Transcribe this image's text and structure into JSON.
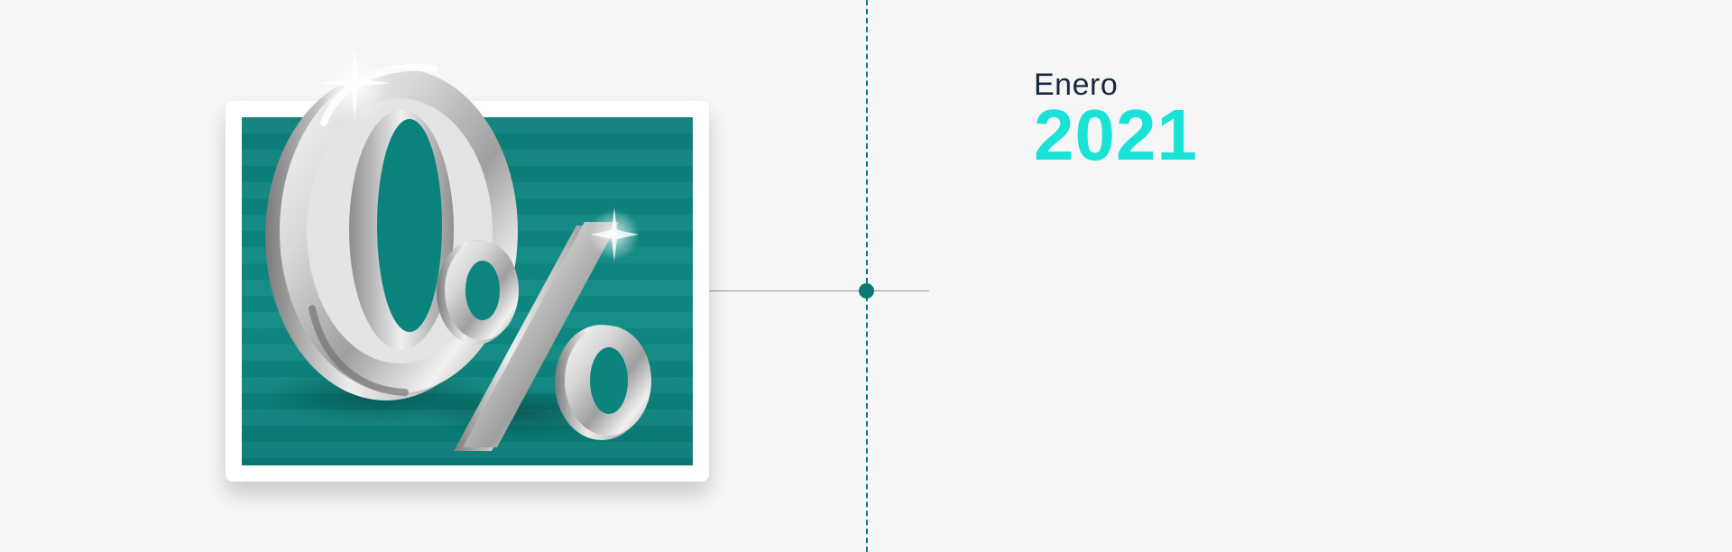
{
  "timeline": {
    "month": "Enero",
    "year": "2021"
  },
  "image": {
    "symbol_icon": "zero-percent-icon"
  },
  "colors": {
    "timeline": "#0b7a75",
    "year": "#19e3d7",
    "month": "#16293f",
    "card_image": "#0e8b84"
  }
}
